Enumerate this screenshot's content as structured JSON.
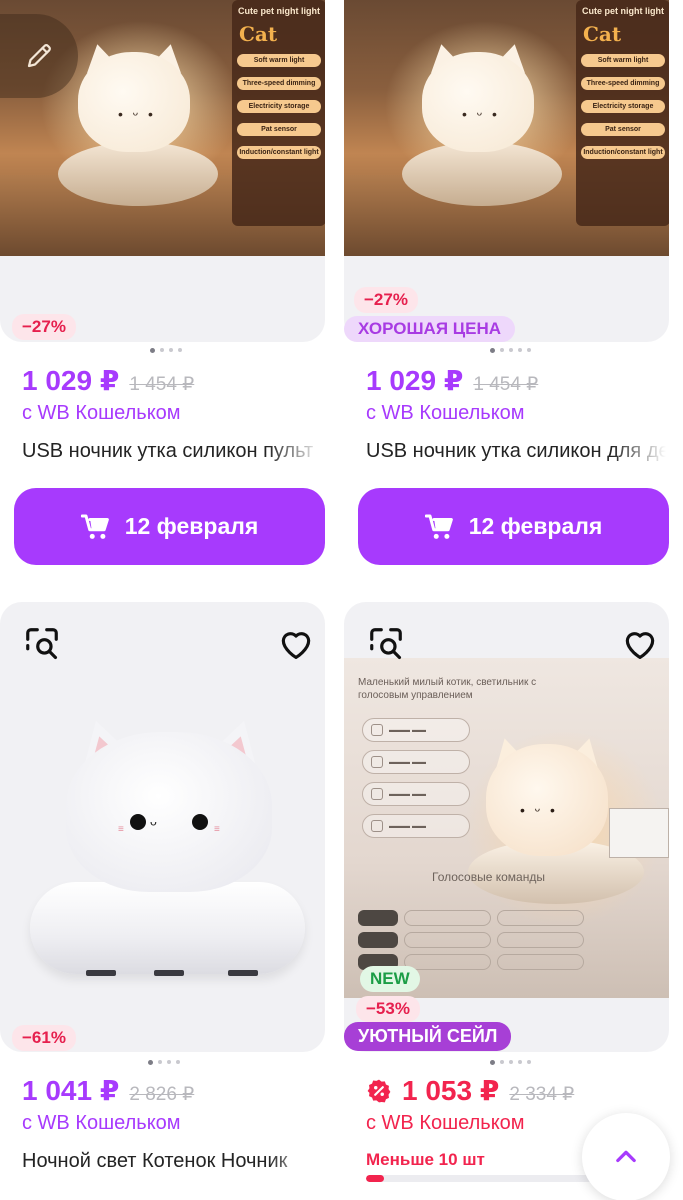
{
  "colors": {
    "accent": "#a73afd",
    "sale_red": "#f2244e",
    "good_price_bg": "#eed8fb",
    "new_green": "#1c9d46"
  },
  "products": [
    {
      "image": {
        "panel_title": "Cute pet night light",
        "panel_name": "Cat",
        "panel_features": [
          "Soft warm light",
          "Three-speed dimming",
          "Electricity storage",
          "Pat sensor",
          "Induction/constant light"
        ]
      },
      "discount": "−27%",
      "price": "1 029 ₽",
      "old_price": "1 454 ₽",
      "wallet": "с WB Кошельком",
      "title": "USB ночник утка силикон пульт",
      "cart_label": "12 февраля",
      "edit_icon": "pencil-icon"
    },
    {
      "image": {
        "panel_title": "Cute pet night light",
        "panel_name": "Cat",
        "panel_features": [
          "Soft warm light",
          "Three-speed dimming",
          "Electricity storage",
          "Pat sensor",
          "Induction/constant light"
        ]
      },
      "discount": "−27%",
      "promo": "ХОРОШАЯ ЦЕНА",
      "price": "1 029 ₽",
      "old_price": "1 454 ₽",
      "wallet": "с WB Кошельком",
      "title": "USB ночник утка силикон для детей",
      "cart_label": "12 февраля"
    },
    {
      "discount": "−61%",
      "price": "1 041 ₽",
      "old_price": "2 826 ₽",
      "wallet": "с WB Кошельком",
      "title": "Ночной свет Котенок Ночник",
      "quick_view_icon": "quick-view-icon",
      "favorite_icon": "heart-icon"
    },
    {
      "image": {
        "headline": "Маленький милый котик, светильник с голосовым управлением",
        "voice_label": "Голосовые команды"
      },
      "new_badge": "NEW",
      "discount": "−53%",
      "promo": "УЮТНЫЙ СЕЙЛ",
      "price": "1 053 ₽",
      "old_price": "2 334 ₽",
      "wallet": "с WB Кошельком",
      "stock": "Меньше 10 шт",
      "stock_level": 0.07,
      "quick_view_icon": "quick-view-icon",
      "favorite_icon": "heart-icon",
      "price_icon": "sale-badge-icon"
    }
  ],
  "scroll_top_icon": "chevron-up-icon"
}
